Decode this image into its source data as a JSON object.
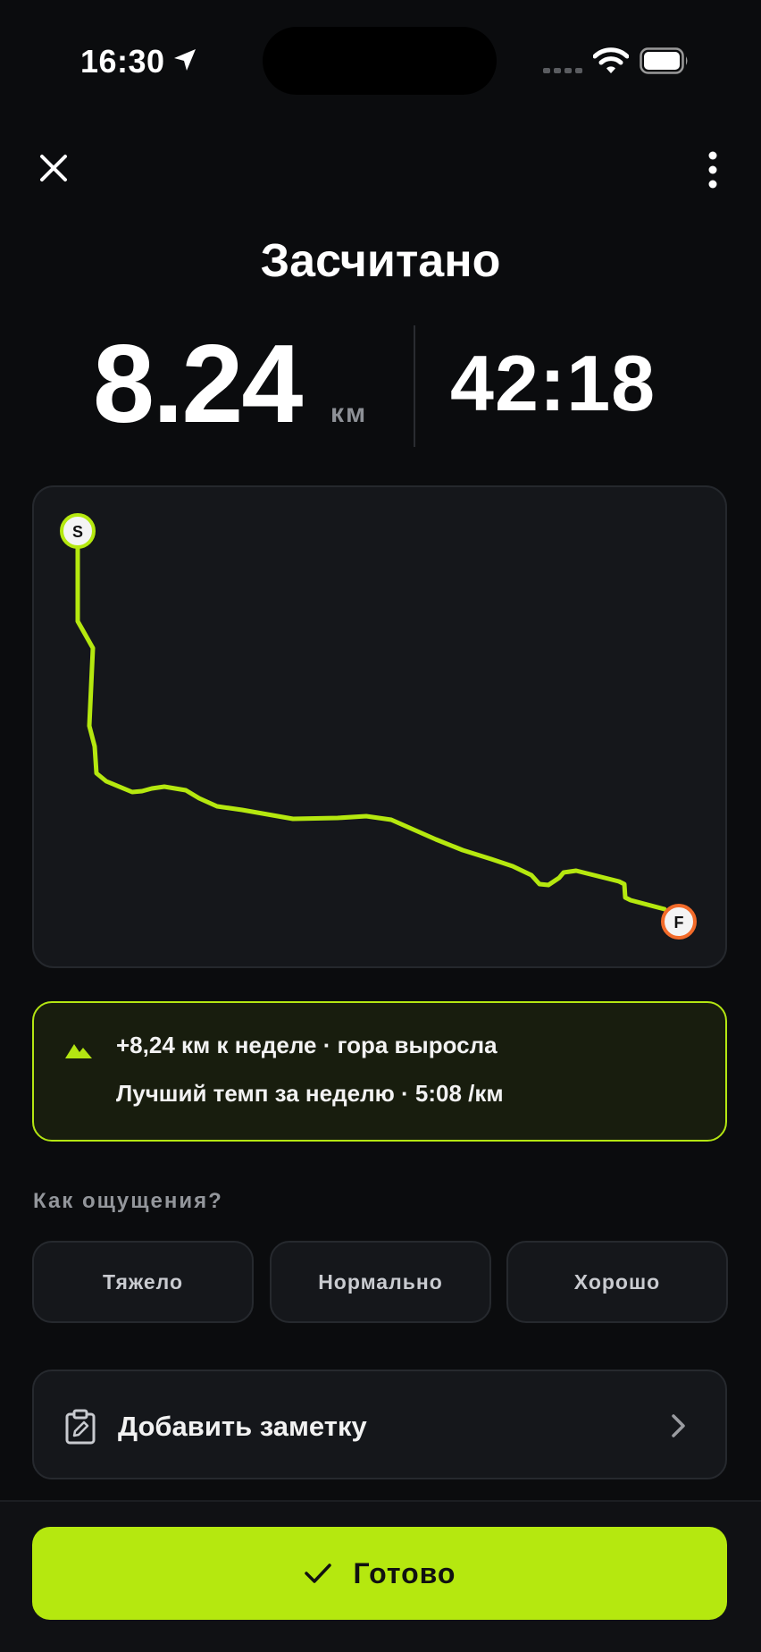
{
  "status_bar": {
    "time": "16:30",
    "location_icon": "location-arrow-icon",
    "signal_icon": "cellular-signal-icon",
    "wifi_icon": "wifi-icon",
    "battery_icon": "battery-icon"
  },
  "header": {
    "close_icon": "close-icon",
    "more_icon": "more-vertical-icon",
    "title": "Засчитано"
  },
  "stats": {
    "distance": "8.24",
    "distance_unit": "км",
    "duration": "42:18"
  },
  "map": {
    "start_label": "S",
    "finish_label": "F",
    "route_color": "#b5e80f",
    "start_marker_color": "#b5e80f",
    "finish_marker_color": "#f26b2a"
  },
  "insight": {
    "icon": "mountain-icon",
    "line1": "+8,24 км к неделе · гора выросла",
    "line2": "Лучший темп за неделю · 5:08 /км",
    "accent": "#b4e612"
  },
  "feel": {
    "label": "Как ощущения?",
    "options": [
      "Тяжело",
      "Нормально",
      "Хорошо"
    ]
  },
  "note": {
    "icon": "clipboard-edit-icon",
    "label": "Добавить заметку",
    "chevron_icon": "chevron-right-icon"
  },
  "footer": {
    "done_label": "Готово",
    "done_icon": "check-icon",
    "accent": "#b5e80f"
  }
}
